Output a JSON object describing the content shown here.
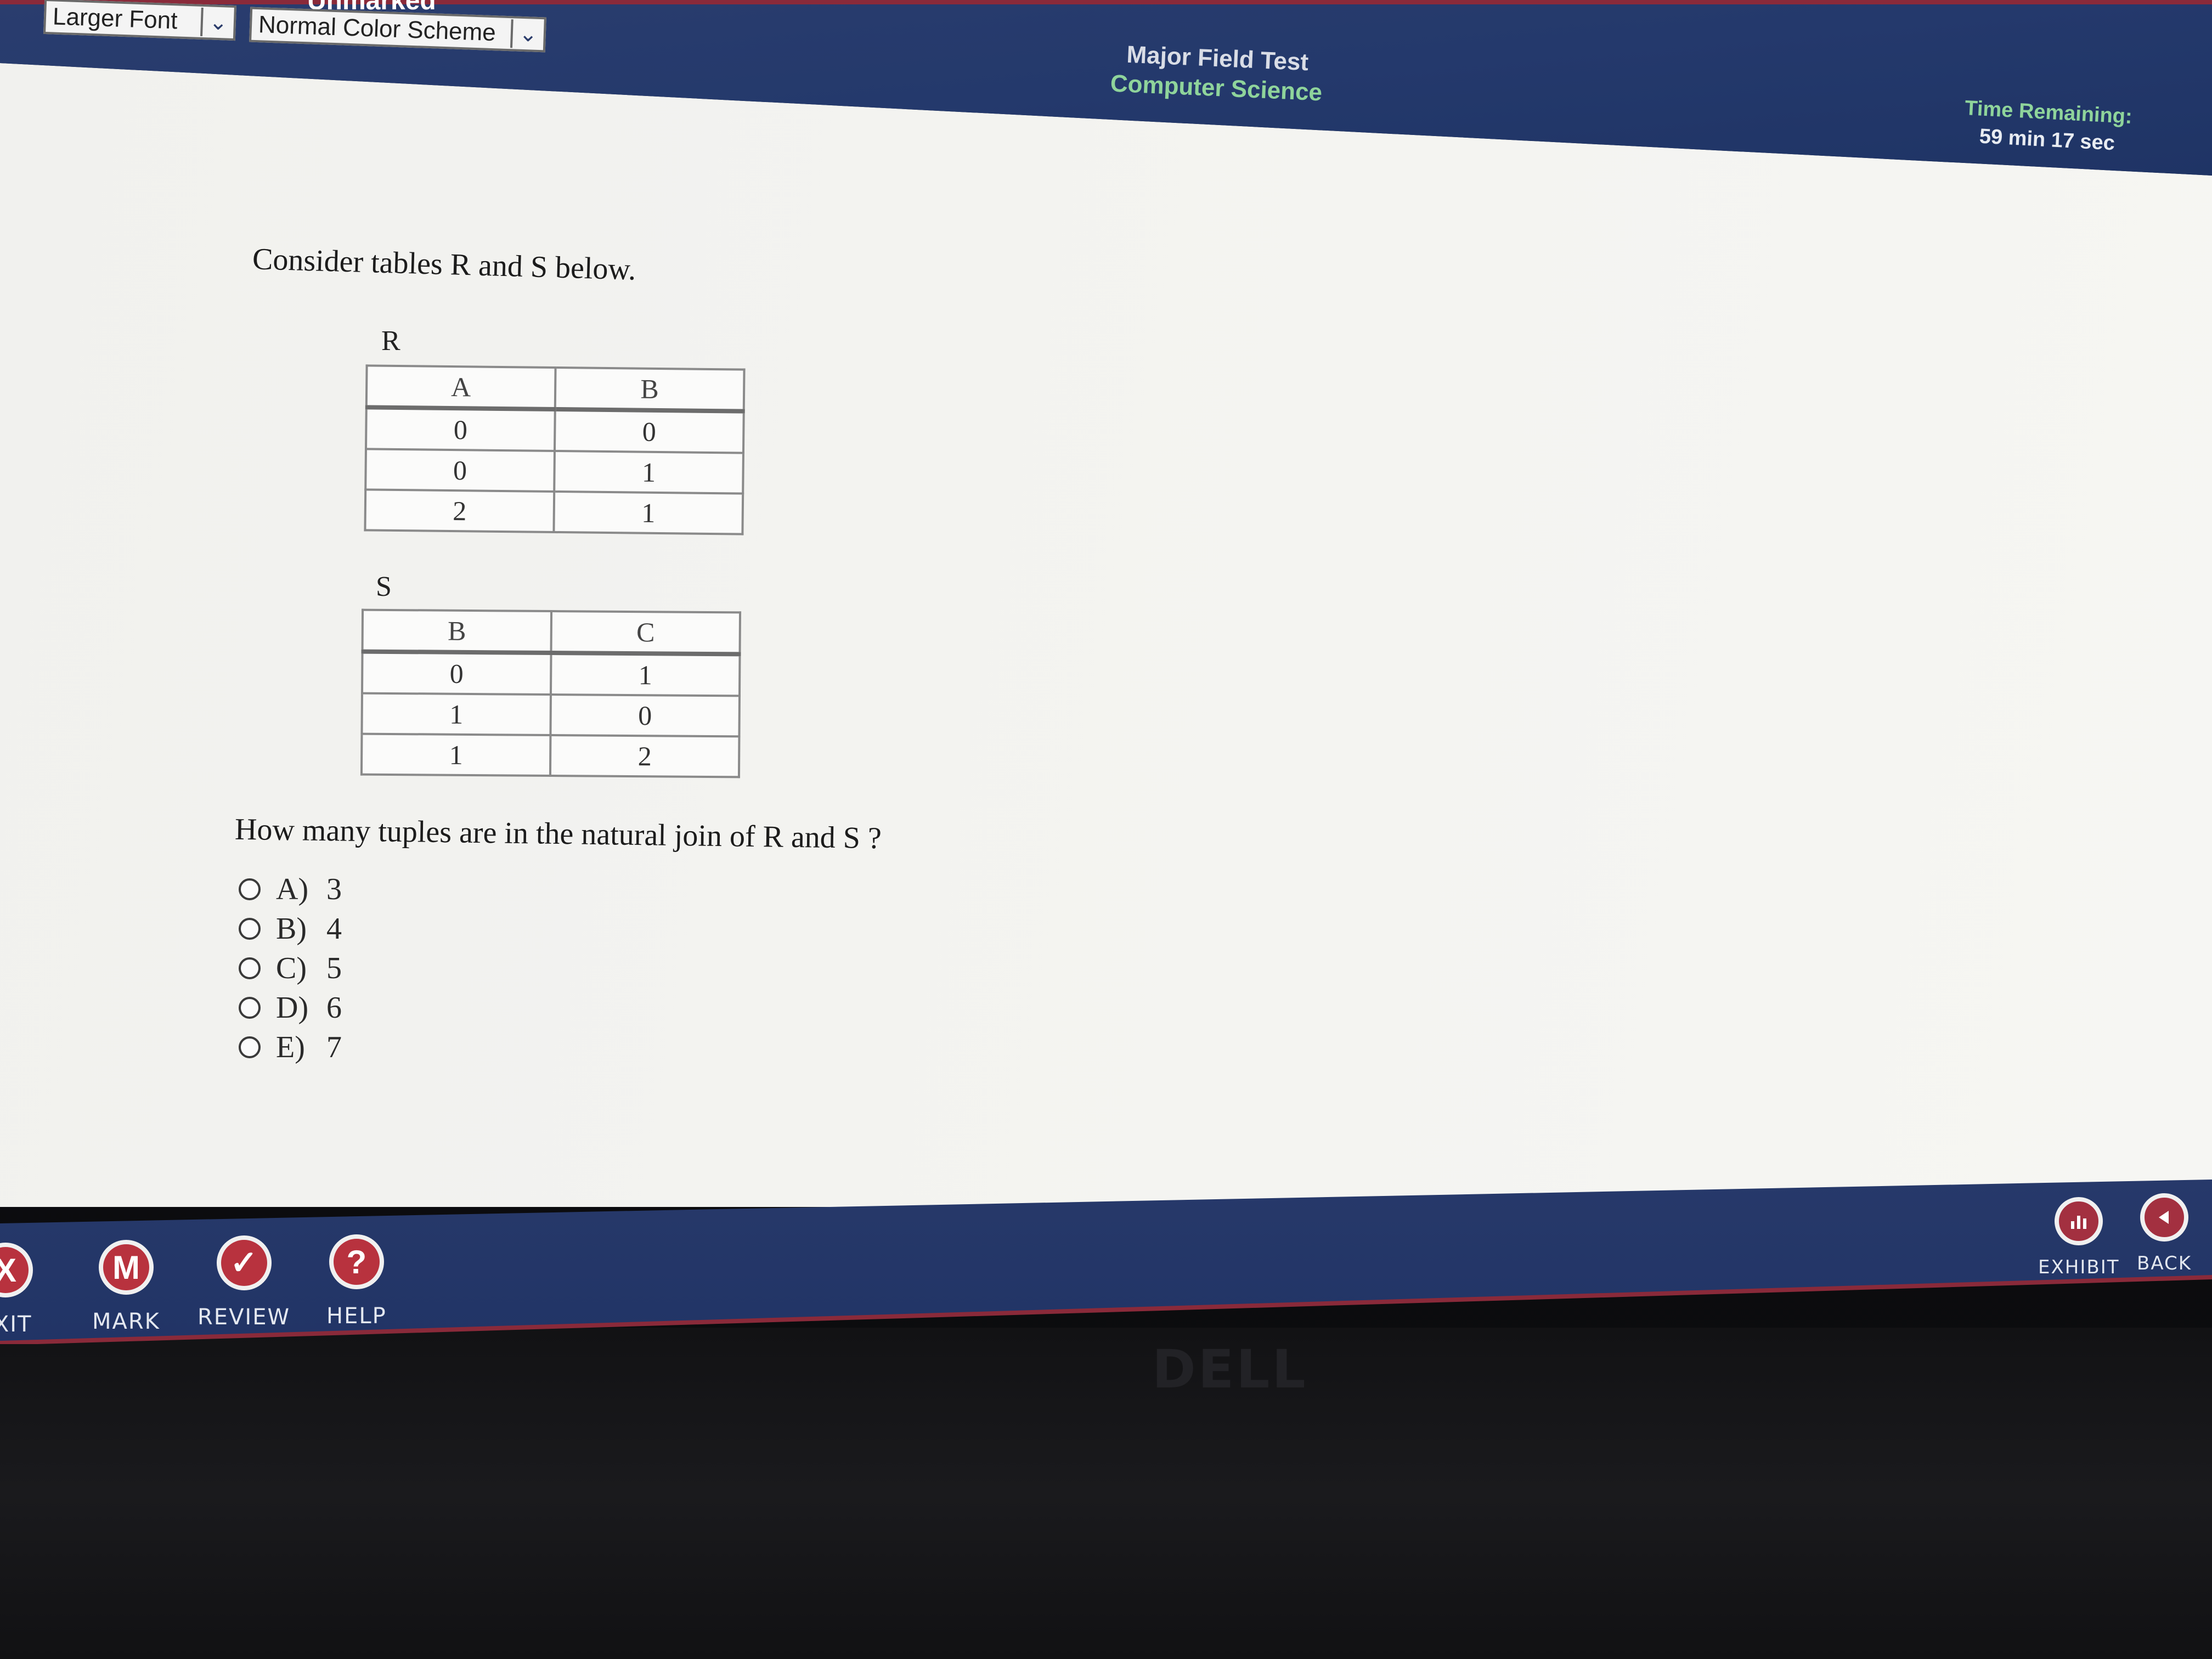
{
  "header": {
    "status": "Unmarked",
    "font_select": "Larger Font",
    "scheme_select": "Normal Color Scheme",
    "title_line1": "Major Field Test",
    "title_line2": "Computer Science",
    "timer_label": "Time Remaining:",
    "timer_value": "59 min 17 sec"
  },
  "question": {
    "intro": "Consider tables R and S below.",
    "prompt": "How many tuples are in the natural join of R and S ?",
    "table_r": {
      "label": "R",
      "headers": [
        "A",
        "B"
      ],
      "rows": [
        [
          "0",
          "0"
        ],
        [
          "0",
          "1"
        ],
        [
          "2",
          "1"
        ]
      ]
    },
    "table_s": {
      "label": "S",
      "headers": [
        "B",
        "C"
      ],
      "rows": [
        [
          "0",
          "1"
        ],
        [
          "1",
          "0"
        ],
        [
          "1",
          "2"
        ]
      ]
    },
    "choices": [
      {
        "letter": "A)",
        "value": "3"
      },
      {
        "letter": "B)",
        "value": "4"
      },
      {
        "letter": "C)",
        "value": "5"
      },
      {
        "letter": "D)",
        "value": "6"
      },
      {
        "letter": "E)",
        "value": "7"
      }
    ]
  },
  "footer": {
    "exit_label": "EXIT",
    "exit_icon": "X",
    "mark_label": "MARK",
    "mark_icon": "M",
    "review_label": "REVIEW",
    "review_icon": "✓",
    "help_label": "HELP",
    "help_icon": "?",
    "exhibit_label": "EXHIBIT",
    "back_label": "BACK"
  },
  "monitor": {
    "brand": "DELL"
  },
  "colors": {
    "header_bg": "#24396c",
    "accent_green": "#8fd49b",
    "button_red": "#b8323e",
    "content_bg": "#f3f3f0"
  }
}
